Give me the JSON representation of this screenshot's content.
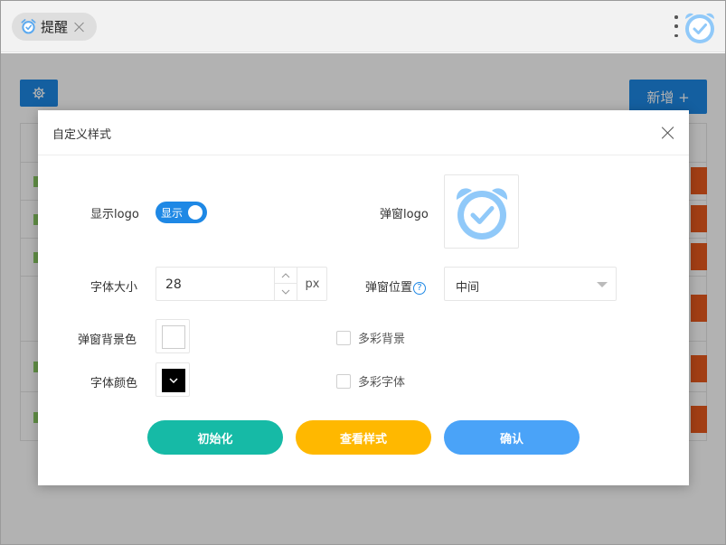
{
  "tabbar": {
    "tab_label": "提醒",
    "tab_icon": "alarm-clock-icon"
  },
  "page": {
    "add_button_label": "新增 +",
    "gear_icon": "gear-icon"
  },
  "dialog": {
    "title": "自定义样式",
    "show_logo_label": "显示logo",
    "show_logo_switch_text": "显示",
    "show_logo_on": true,
    "popup_logo_label": "弹窗logo",
    "font_size_label": "字体大小",
    "font_size_value": "28",
    "font_size_unit": "px",
    "popup_position_label": "弹窗位置",
    "popup_position_value": "中间",
    "bg_color_label": "弹窗背景色",
    "bg_color_value": "#ffffff",
    "font_color_label": "字体颜色",
    "font_color_value": "#000000",
    "colorful_bg_label": "多彩背景",
    "colorful_font_label": "多彩字体",
    "buttons": {
      "init": "初始化",
      "preview": "查看样式",
      "confirm": "确认"
    }
  },
  "colors": {
    "primary": "#1e88e5",
    "init_button": "#16baa6",
    "preview_button": "#ffb800",
    "confirm_button": "#4aa3f8",
    "logo_blue": "#90c9f9"
  }
}
